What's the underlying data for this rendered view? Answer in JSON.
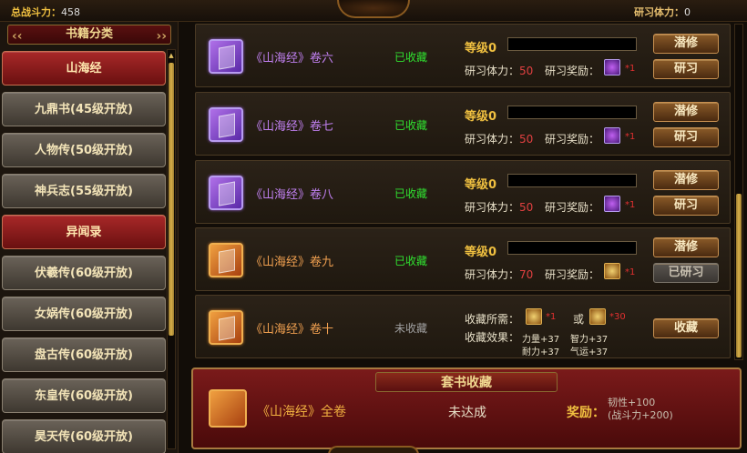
{
  "top": {
    "power_label": "总战斗力：",
    "power_value": "458",
    "stamina_label": "研习体力：",
    "stamina_value": "0"
  },
  "categories": {
    "header": "书籍分类",
    "items": [
      {
        "label": "山海经",
        "active": true
      },
      {
        "label": "九鼎书(45级开放)",
        "active": false
      },
      {
        "label": "人物传(50级开放)",
        "active": false
      },
      {
        "label": "神兵志(55级开放)",
        "active": false
      },
      {
        "label": "异闻录",
        "active": true
      },
      {
        "label": "伏羲传(60级开放)",
        "active": false
      },
      {
        "label": "女娲传(60级开放)",
        "active": false
      },
      {
        "label": "盘古传(60级开放)",
        "active": false
      },
      {
        "label": "东皇传(60级开放)",
        "active": false
      },
      {
        "label": "昊天传(60级开放)",
        "active": false
      }
    ]
  },
  "books": [
    {
      "name": "《山海经》卷六",
      "status": "已收藏",
      "level": "等级0",
      "stamina_label": "研习体力：",
      "stamina": "50",
      "reward_label": "研习奖励：",
      "reward_count": "*1",
      "btn1": "潜修",
      "btn2": "研习",
      "color": "purple"
    },
    {
      "name": "《山海经》卷七",
      "status": "已收藏",
      "level": "等级0",
      "stamina_label": "研习体力：",
      "stamina": "50",
      "reward_label": "研习奖励：",
      "reward_count": "*1",
      "btn1": "潜修",
      "btn2": "研习",
      "color": "purple"
    },
    {
      "name": "《山海经》卷八",
      "status": "已收藏",
      "level": "等级0",
      "stamina_label": "研习体力：",
      "stamina": "50",
      "reward_label": "研习奖励：",
      "reward_count": "*1",
      "btn1": "潜修",
      "btn2": "研习",
      "color": "purple"
    },
    {
      "name": "《山海经》卷九",
      "status": "已收藏",
      "level": "等级0",
      "stamina_label": "研习体力：",
      "stamina": "70",
      "reward_label": "研习奖励：",
      "reward_count": "*1",
      "btn1": "潜修",
      "btn2": "已研习",
      "color": "orange"
    }
  ],
  "collect_book": {
    "name": "《山海经》卷十",
    "status": "未收藏",
    "need_label": "收藏所需：",
    "need_count1": "*1",
    "or": "或",
    "need_count2": "*30",
    "effect_label": "收藏效果：",
    "attrs": [
      "力量+37",
      "智力+37",
      "耐力+37",
      "气运+37"
    ],
    "button": "收藏"
  },
  "set": {
    "header": "套书收藏",
    "name": "《山海经》全卷",
    "status": "未达成",
    "reward_label": "奖励：",
    "reward_line1": "韧性+100",
    "reward_line2": "(战斗力+200)"
  }
}
